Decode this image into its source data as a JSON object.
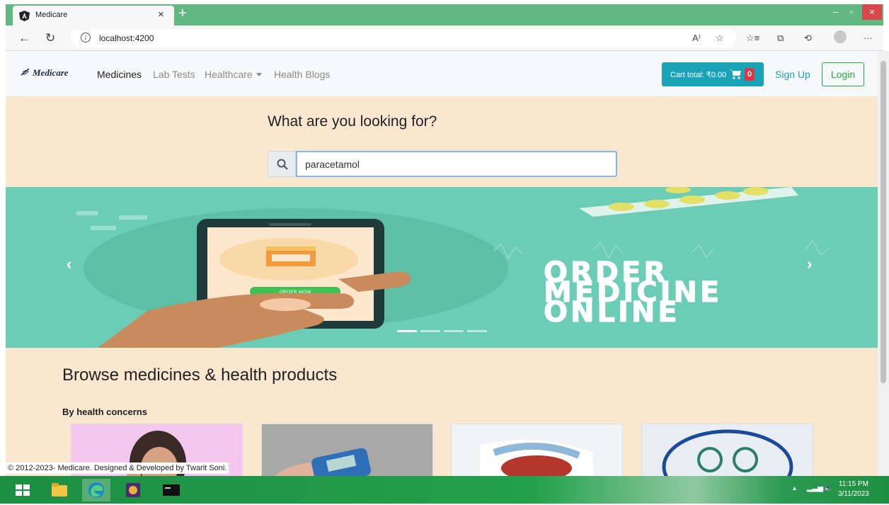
{
  "browser": {
    "tab_title": "Medicare",
    "url": "localhost:4200"
  },
  "navbar": {
    "brand": "Medicare",
    "links": [
      "Medicines",
      "Lab Tests",
      "Healthcare",
      "Health Blogs"
    ],
    "cart_label": "Cart total: ₹0.00",
    "cart_count": "0",
    "signup": "Sign Up",
    "login": "Login"
  },
  "search": {
    "heading": "What are you looking for?",
    "value": "paracetamol"
  },
  "carousel": {
    "button_text": "ORDER NOW",
    "lines": [
      "ORDER",
      "MEDICINE",
      "ONLINE"
    ]
  },
  "browse": {
    "title": "Browse medicines & health products",
    "subtitle": "By health concerns"
  },
  "footer": {
    "text": "© 2012-2023- Medicare. Designed & Developed by Twarit Soni."
  },
  "taskbar": {
    "time": "11:15 PM",
    "date": "3/11/2023"
  },
  "colors": {
    "accent": "#1aa2b9",
    "login": "#28a745",
    "page_bg": "#fae7d0",
    "carousel_bg": "#6ccdb7",
    "tabbar": "#63b882"
  }
}
